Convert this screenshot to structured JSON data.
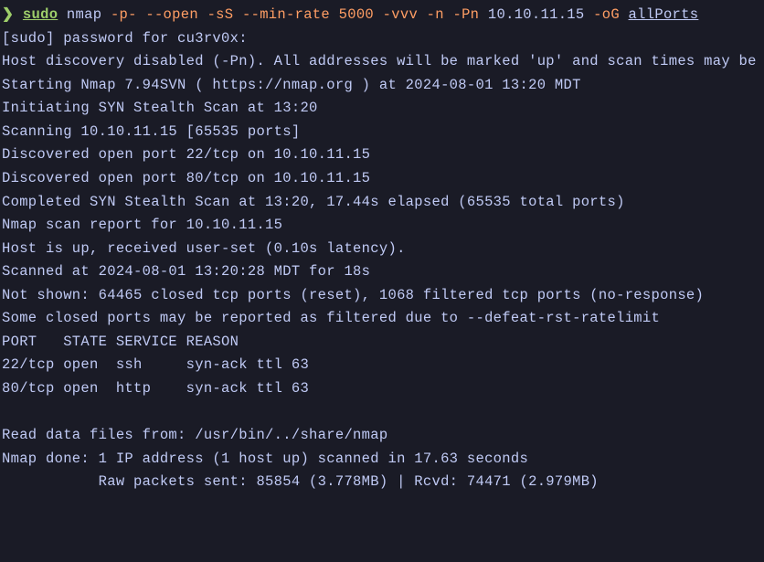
{
  "prompt": {
    "arrow": "❯",
    "sudo": "sudo",
    "nmap": "nmap",
    "flag_p": "-p-",
    "flag_open": "--open",
    "flag_ss": "-sS",
    "flag_minrate": "--min-rate",
    "minrate_val": "5000",
    "flag_vvv": "-vvv",
    "flag_n": "-n",
    "flag_pn": "-Pn",
    "ip": "10.10.11.15",
    "flag_og": "-oG",
    "allports": "allPorts"
  },
  "output": {
    "l1": "[sudo] password for cu3rv0x:",
    "l2": "Host discovery disabled (-Pn). All addresses will be marked 'up' and scan times may be slower.",
    "l3": "Starting Nmap 7.94SVN ( https://nmap.org ) at 2024-08-01 13:20 MDT",
    "l4": "Initiating SYN Stealth Scan at 13:20",
    "l5": "Scanning 10.10.11.15 [65535 ports]",
    "l6": "Discovered open port 22/tcp on 10.10.11.15",
    "l7": "Discovered open port 80/tcp on 10.10.11.15",
    "l8": "Completed SYN Stealth Scan at 13:20, 17.44s elapsed (65535 total ports)",
    "l9": "Nmap scan report for 10.10.11.15",
    "l10": "Host is up, received user-set (0.10s latency).",
    "l11": "Scanned at 2024-08-01 13:20:28 MDT for 18s",
    "l12": "Not shown: 64465 closed tcp ports (reset), 1068 filtered tcp ports (no-response)",
    "l13": "Some closed ports may be reported as filtered due to --defeat-rst-ratelimit",
    "l14": "PORT   STATE SERVICE REASON",
    "l15": "22/tcp open  ssh     syn-ack ttl 63",
    "l16": "80/tcp open  http    syn-ack ttl 63",
    "l17": "Read data files from: /usr/bin/../share/nmap",
    "l18": "Nmap done: 1 IP address (1 host up) scanned in 17.63 seconds",
    "l19": "           Raw packets sent: 85854 (3.778MB) | Rcvd: 74471 (2.979MB)"
  }
}
